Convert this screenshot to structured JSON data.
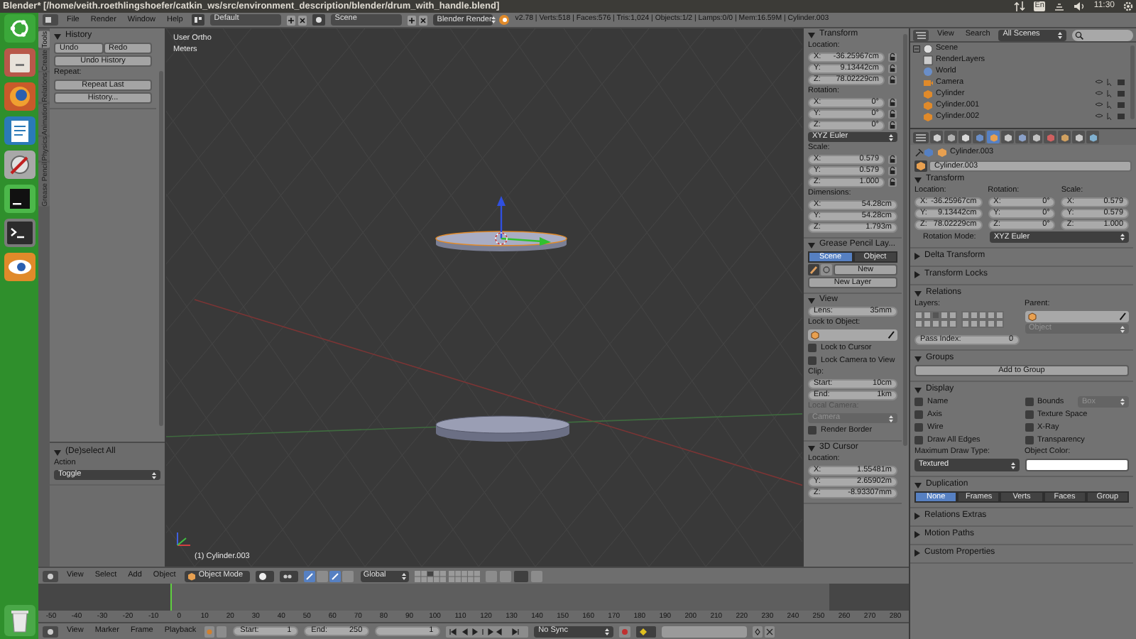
{
  "window": {
    "title": "Blender* [/home/veith.roethlingshoefer/catkin_ws/src/environment_description/blender/drum_with_handle.blend]"
  },
  "tray": {
    "keyboard": "En",
    "time": "11:30"
  },
  "info_header": {
    "menus": [
      "File",
      "Render",
      "Window",
      "Help"
    ],
    "layout": "Default",
    "scene": "Scene",
    "engine": "Blender Render",
    "stats": "v2.78 | Verts:518 | Faces:576 | Tris:1,024 | Objects:1/2 | Lamps:0/0 | Mem:16.59M | Cylinder.003"
  },
  "tool_shelf": {
    "tabs": [
      {
        "label": "Tools",
        "selected": true
      },
      {
        "label": "Create",
        "selected": false
      },
      {
        "label": "Relations",
        "selected": false
      },
      {
        "label": "Animation",
        "selected": false
      },
      {
        "label": "Physics",
        "selected": false
      },
      {
        "label": "Grease Pencil",
        "selected": false
      }
    ],
    "panels": [
      {
        "title": "History",
        "expanded": true,
        "rows": [
          {
            "kind": "buttons",
            "labels": [
              "Undo",
              "Redo"
            ]
          },
          {
            "kind": "button",
            "label": "Undo History"
          },
          {
            "kind": "label",
            "text": "Repeat:"
          },
          {
            "kind": "button",
            "label": "Repeat Last"
          },
          {
            "kind": "button",
            "label": "History..."
          }
        ]
      }
    ],
    "redo_panels": [
      {
        "title": "(De)select All",
        "expanded": true,
        "rows": [
          {
            "kind": "label",
            "text": "Action"
          },
          {
            "kind": "dropdown",
            "value": "Toggle"
          }
        ]
      }
    ]
  },
  "viewport": {
    "view_name": "User Ortho",
    "units": "Meters",
    "object_info": "(1) Cylinder.003"
  },
  "n_panel": {
    "panels": [
      {
        "title": "Transform",
        "expanded": true,
        "rows": [
          {
            "kind": "label",
            "text": "Location:"
          },
          {
            "kind": "locked_field",
            "label": "X:",
            "value": "-36.25967cm"
          },
          {
            "kind": "locked_field",
            "label": "Y:",
            "value": "9.13442cm"
          },
          {
            "kind": "locked_field",
            "label": "Z:",
            "value": "78.02229cm"
          },
          {
            "kind": "label",
            "text": "Rotation:"
          },
          {
            "kind": "locked_field",
            "label": "X:",
            "value": "0°"
          },
          {
            "kind": "locked_field",
            "label": "Y:",
            "value": "0°"
          },
          {
            "kind": "locked_field",
            "label": "Z:",
            "value": "0°"
          },
          {
            "kind": "dropdown",
            "value": "XYZ Euler"
          },
          {
            "kind": "label",
            "text": "Scale:"
          },
          {
            "kind": "locked_field",
            "label": "X:",
            "value": "0.579"
          },
          {
            "kind": "locked_field",
            "label": "Y:",
            "value": "0.579"
          },
          {
            "kind": "locked_field",
            "label": "Z:",
            "value": "1.000"
          },
          {
            "kind": "label",
            "text": "Dimensions:"
          },
          {
            "kind": "field",
            "label": "X:",
            "value": "54.28cm"
          },
          {
            "kind": "field",
            "label": "Y:",
            "value": "54.28cm"
          },
          {
            "kind": "field",
            "label": "Z:",
            "value": "1.793m"
          }
        ]
      },
      {
        "title": "Grease Pencil Lay...",
        "expanded": true,
        "rows": [
          {
            "kind": "toggle_group",
            "options": [
              {
                "label": "Scene",
                "selected": true
              },
              {
                "label": "Object",
                "selected": false
              }
            ]
          },
          {
            "kind": "new_datablock",
            "label": "New"
          },
          {
            "kind": "button",
            "label": "New Layer"
          }
        ]
      },
      {
        "title": "View",
        "expanded": true,
        "rows": [
          {
            "kind": "field",
            "label": "Lens:",
            "value": "35mm"
          },
          {
            "kind": "label",
            "text": "Lock to Object:"
          },
          {
            "kind": "object_field"
          },
          {
            "kind": "checkbox",
            "label": "Lock to Cursor",
            "checked": false
          },
          {
            "kind": "checkbox",
            "label": "Lock Camera to View",
            "checked": false
          },
          {
            "kind": "label",
            "text": "Clip:"
          },
          {
            "kind": "field",
            "label": "Start:",
            "value": "10cm"
          },
          {
            "kind": "field",
            "label": "End:",
            "value": "1km"
          },
          {
            "kind": "label",
            "text": "Local Camera:",
            "disabled": true
          },
          {
            "kind": "dropdown",
            "value": "Camera",
            "disabled": true
          },
          {
            "kind": "checkbox",
            "label": "Render Border",
            "checked": false
          }
        ]
      },
      {
        "title": "3D Cursor",
        "expanded": true,
        "rows": [
          {
            "kind": "label",
            "text": "Location:"
          },
          {
            "kind": "field",
            "label": "X:",
            "value": "1.55481m"
          },
          {
            "kind": "field",
            "label": "Y:",
            "value": "2.65902m"
          },
          {
            "kind": "field",
            "label": "Z:",
            "value": "-8.93307mm"
          }
        ]
      }
    ]
  },
  "outliner": {
    "menus": [
      "View",
      "Search"
    ],
    "filter": "All Scenes",
    "tree": [
      {
        "label": "Scene",
        "kind": "scene",
        "expanded": true,
        "children": [
          {
            "label": "RenderLayers",
            "kind": "render_layers"
          },
          {
            "label": "World",
            "kind": "world"
          },
          {
            "label": "Camera",
            "kind": "camera"
          },
          {
            "label": "Cylinder",
            "kind": "mesh"
          },
          {
            "label": "Cylinder.001",
            "kind": "mesh"
          },
          {
            "label": "Cylinder.002",
            "kind": "mesh"
          }
        ]
      }
    ]
  },
  "properties": {
    "tabs": [
      {
        "kind": "render",
        "selected": false
      },
      {
        "kind": "layers",
        "selected": false
      },
      {
        "kind": "scene",
        "selected": false
      },
      {
        "kind": "world",
        "selected": false
      },
      {
        "kind": "object",
        "selected": true
      },
      {
        "kind": "constraints",
        "selected": false
      },
      {
        "kind": "modifiers",
        "selected": false
      },
      {
        "kind": "data",
        "selected": false
      },
      {
        "kind": "material",
        "selected": false
      },
      {
        "kind": "texture",
        "selected": false
      },
      {
        "kind": "particles",
        "selected": false
      },
      {
        "kind": "physics",
        "selected": false
      }
    ],
    "breadcrumb": "Cylinder.003",
    "name": "Cylinder.003",
    "panels": [
      {
        "title": "Transform",
        "expanded": true,
        "rows": [
          {
            "kind": "columns",
            "columns": [
              [
                {
                  "kind": "label",
                  "text": "Location:"
                },
                {
                  "kind": "field",
                  "label": "X:",
                  "value": "-36.25967cm"
                },
                {
                  "kind": "field",
                  "label": "Y:",
                  "value": "9.13442cm"
                },
                {
                  "kind": "field",
                  "label": "Z:",
                  "value": "78.02229cm"
                }
              ],
              [
                {
                  "kind": "label",
                  "text": "Rotation:"
                },
                {
                  "kind": "field",
                  "label": "X:",
                  "value": "0°"
                },
                {
                  "kind": "field",
                  "label": "Y:",
                  "value": "0°"
                },
                {
                  "kind": "field",
                  "label": "Z:",
                  "value": "0°"
                }
              ],
              [
                {
                  "kind": "label",
                  "text": "Scale:"
                },
                {
                  "kind": "field",
                  "label": "X:",
                  "value": "0.579"
                },
                {
                  "kind": "field",
                  "label": "Y:",
                  "value": "0.579"
                },
                {
                  "kind": "field",
                  "label": "Z:",
                  "value": "1.000"
                }
              ]
            ]
          },
          {
            "kind": "labeled_dropdown",
            "label": "Rotation Mode:",
            "value": "XYZ Euler"
          }
        ]
      },
      {
        "title": "Delta Transform",
        "expanded": false
      },
      {
        "title": "Transform Locks",
        "expanded": false
      },
      {
        "title": "Relations",
        "expanded": true,
        "rows": [
          {
            "kind": "columns",
            "columns": [
              [
                {
                  "kind": "label",
                  "text": "Layers:"
                },
                {
                  "kind": "layers",
                  "layers": [
                    {
                      "selected": false
                    },
                    {
                      "selected": false
                    },
                    {
                      "selected": true
                    },
                    {
                      "selected": false
                    },
                    {
                      "selected": false
                    },
                    {
                      "selected": false
                    },
                    {
                      "selected": false
                    },
                    {
                      "selected": false
                    },
                    {
                      "selected": false
                    },
                    {
                      "selected": false
                    },
                    {
                      "selected": false
                    },
                    {
                      "selected": false
                    },
                    {
                      "selected": false
                    },
                    {
                      "selected": false
                    },
                    {
                      "selected": false
                    },
                    {
                      "selected": false
                    },
                    {
                      "selected": false
                    },
                    {
                      "selected": false
                    },
                    {
                      "selected": false
                    },
                    {
                      "selected": false
                    }
                  ]
                }
              ],
              [
                {
                  "kind": "label",
                  "text": "Parent:"
                },
                {
                  "kind": "object_field"
                },
                {
                  "kind": "dropdown",
                  "value": "Object",
                  "disabled": true
                }
              ]
            ]
          },
          {
            "kind": "columns",
            "columns": [
              [
                {
                  "kind": "field",
                  "label": "Pass Index:",
                  "value": "0"
                }
              ]
            ]
          }
        ]
      },
      {
        "title": "Groups",
        "expanded": true,
        "rows": [
          {
            "kind": "button",
            "label": "Add to Group"
          }
        ]
      },
      {
        "title": "Display",
        "expanded": true,
        "rows": [
          {
            "kind": "columns",
            "columns": [
              [
                {
                  "kind": "checkbox",
                  "label": "Name",
                  "checked": false
                },
                {
                  "kind": "checkbox",
                  "label": "Axis",
                  "checked": false
                },
                {
                  "kind": "checkbox",
                  "label": "Wire",
                  "checked": false
                },
                {
                  "kind": "checkbox",
                  "label": "Draw All Edges",
                  "checked": false
                }
              ],
              [
                {
                  "kind": "checkbox_dropdown",
                  "label": "Bounds",
                  "checked": false,
                  "value": "Box",
                  "disabled": true
                },
                {
                  "kind": "checkbox",
                  "label": "Texture Space",
                  "checked": false
                },
                {
                  "kind": "checkbox",
                  "label": "X-Ray",
                  "checked": false
                },
                {
                  "kind": "checkbox",
                  "label": "Transparency",
                  "checked": false
                }
              ]
            ]
          },
          {
            "kind": "columns",
            "columns": [
              [
                {
                  "kind": "label",
                  "text": "Maximum Draw Type:"
                },
                {
                  "kind": "dropdown",
                  "value": "Textured"
                }
              ],
              [
                {
                  "kind": "label",
                  "text": "Object Color:"
                },
                {
                  "kind": "color_field",
                  "color": "#ffffff"
                }
              ]
            ]
          }
        ]
      },
      {
        "title": "Duplication",
        "expanded": true,
        "rows": [
          {
            "kind": "toggle_group",
            "options": [
              {
                "label": "None",
                "selected": true
              },
              {
                "label": "Frames",
                "selected": false
              },
              {
                "label": "Verts",
                "selected": false
              },
              {
                "label": "Faces",
                "selected": false
              },
              {
                "label": "Group",
                "selected": false
              }
            ]
          }
        ]
      },
      {
        "title": "Relations Extras",
        "expanded": false
      },
      {
        "title": "Motion Paths",
        "expanded": false
      },
      {
        "title": "Custom Properties",
        "expanded": false
      }
    ]
  },
  "view3d_header": {
    "menus": [
      "View",
      "Select",
      "Add",
      "Object"
    ],
    "mode": "Object Mode",
    "orientation": "Global"
  },
  "timeline": {
    "ruler": [
      "-50",
      "-40",
      "-30",
      "-20",
      "-10",
      "0",
      "10",
      "20",
      "30",
      "40",
      "50",
      "60",
      "70",
      "80",
      "90",
      "100",
      "110",
      "120",
      "130",
      "140",
      "150",
      "160",
      "170",
      "180",
      "190",
      "200",
      "210",
      "220",
      "230",
      "240",
      "250",
      "260",
      "270",
      "280"
    ],
    "menus": [
      "View",
      "Marker",
      "Frame",
      "Playback"
    ],
    "start_label": "Start:",
    "start": "1",
    "end_label": "End:",
    "end": "250",
    "current": "1",
    "sync": "No Sync"
  }
}
